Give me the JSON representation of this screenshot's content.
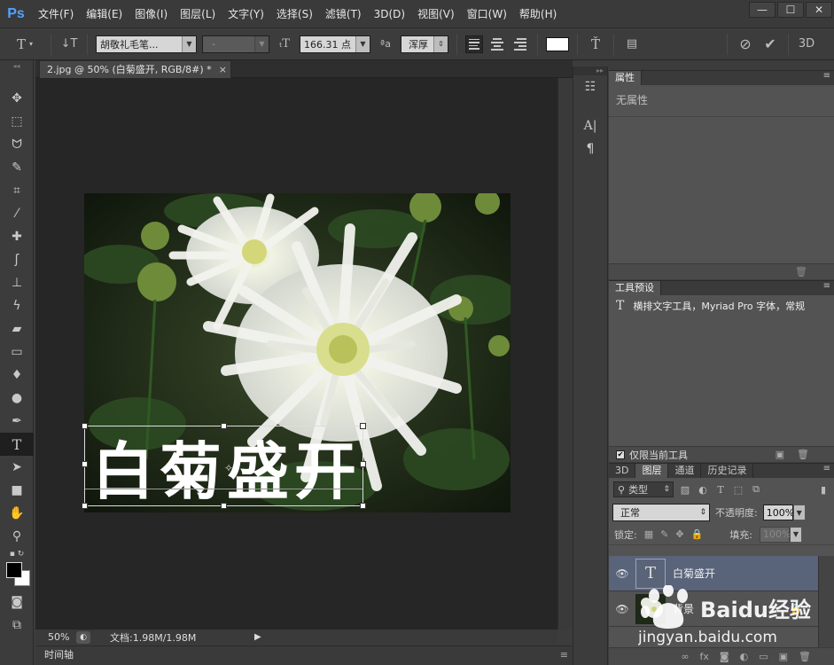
{
  "app": {
    "logo": "Ps",
    "window_buttons": [
      "—",
      "☐",
      "✕"
    ]
  },
  "menu": [
    "文件(F)",
    "编辑(E)",
    "图像(I)",
    "图层(L)",
    "文字(Y)",
    "选择(S)",
    "滤镜(T)",
    "3D(D)",
    "视图(V)",
    "窗口(W)",
    "帮助(H)"
  ],
  "options": {
    "font_family": "胡敬礼毛笔...",
    "font_style": "-",
    "font_size": "166.31 点",
    "aa_label": "ªa",
    "antialias": "浑厚",
    "text_color": "#ffffff",
    "threed_label": "3D"
  },
  "document": {
    "tab_title": "2.jpg @ 50% (白菊盛开, RGB/8#) *",
    "tab_close": "×",
    "text_layer_content": "白菊盛开",
    "zoom": "50%",
    "doc_info": "文档:1.98M/1.98M",
    "timeline_label": "时间轴"
  },
  "panels": {
    "properties": {
      "tab": "属性",
      "body": "无属性"
    },
    "presets": {
      "tab": "工具预设",
      "item": "横排文字工具，Myriad Pro 字体，常规",
      "current_tool_only": "仅限当前工具"
    },
    "layers": {
      "tabs": [
        "3D",
        "图层",
        "通道",
        "历史记录"
      ],
      "active_tab_index": 1,
      "kind_filter": "类型",
      "blend_mode": "正常",
      "opacity_label": "不透明度:",
      "opacity_value": "100%",
      "lock_label": "锁定:",
      "fill_label": "填充:",
      "fill_value": "100%",
      "items": [
        {
          "name": "白菊盛开",
          "type": "text",
          "selected": true
        },
        {
          "name": "背景",
          "type": "image",
          "locked": true
        }
      ]
    }
  },
  "watermark": {
    "brand": "Baidu经验",
    "url": "jingyan.baidu.com"
  },
  "colors": {
    "accent": "#4fa3ff",
    "selected_layer": "#59637a",
    "canvas_bg": "#262626"
  }
}
